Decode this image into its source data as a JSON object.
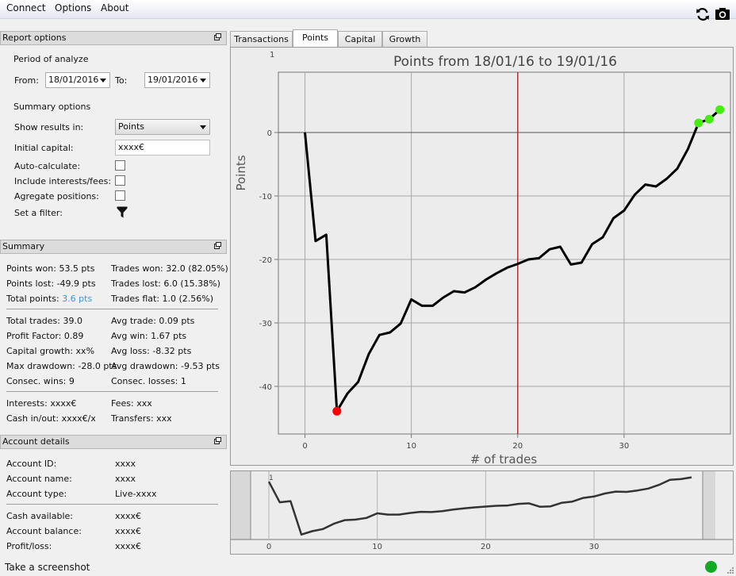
{
  "menu": {
    "connect": "Connect",
    "options": "Options",
    "about": "About"
  },
  "toolbar": {
    "refresh_icon": "refresh-icon",
    "camera_icon": "camera-icon"
  },
  "report_options": {
    "title": "Report options",
    "period_label": "Period of analyze",
    "from_label": "From:",
    "from_value": "18/01/2016",
    "to_label": "To:",
    "to_value": "19/01/2016",
    "summary_options_label": "Summary options",
    "show_results_label": "Show results in:",
    "show_results_value": "Points",
    "initial_capital_label": "Initial capital:",
    "initial_capital_value": "xxxx€",
    "auto_calc_label": "Auto-calculate:",
    "include_fees_label": "Include interests/fees:",
    "aggregate_label": "Agregate positions:",
    "filter_label": "Set a filter:"
  },
  "summary": {
    "title": "Summary",
    "points_won": "Points won: 53.5 pts",
    "trades_won": "Trades won: 32.0 (82.05%)",
    "points_lost": "Points lost: -49.9 pts",
    "trades_lost": "Trades lost: 6.0 (15.38%)",
    "total_points_label": "Total points:",
    "total_points_value": "3.6 pts",
    "trades_flat": "Trades flat: 1.0 (2.56%)",
    "total_trades": "Total trades: 39.0",
    "avg_trade": "Avg trade: 0.09 pts",
    "profit_factor": "Profit Factor: 0.89",
    "avg_win": "Avg win: 1.67 pts",
    "capital_growth": "Capital growth: xx%",
    "avg_loss": "Avg loss: -8.32 pts",
    "max_drawdown": "Max drawdown: -28.0 pts",
    "avg_drawdown": "Avg drawdown: -9.53 pts",
    "consec_wins": "Consec. wins: 9",
    "consec_losses": "Consec. losses: 1",
    "interests": "Interests: xxxx€",
    "fees": "Fees: xxx",
    "cash_inout": "Cash in/out: xxxx€/xxx",
    "transfers": "Transfers: xxxx"
  },
  "account": {
    "title": "Account details",
    "id_label": "Account ID:",
    "id_value": "xxxx",
    "name_label": "Account name:",
    "name_value": "xxxx",
    "type_label": "Account type:",
    "type_value": "Live-xxxx",
    "cash_label": "Cash available:",
    "cash_value": "xxxx€",
    "balance_label": "Account balance:",
    "balance_value": "xxxx€",
    "pl_label": "Profit/loss:",
    "pl_value": "xxxx€"
  },
  "tabs": [
    "Transactions",
    "Points",
    "Capital",
    "Growth"
  ],
  "active_tab": "Points",
  "status": {
    "text": "Take a screenshot",
    "indicator_color": "#11aa22"
  },
  "colors": {
    "line": "#000000",
    "min_marker": "#ff0000",
    "end_markers": "#44ee11",
    "vline": "#aa3333"
  },
  "chart_data": {
    "type": "line",
    "title": "Points from 18/01/16 to 19/01/16",
    "xlabel": "# of trades",
    "ylabel": "Points",
    "x_ticks": [
      0,
      10,
      20,
      30
    ],
    "y_ticks": [
      0,
      -10,
      -20,
      -30,
      -40
    ],
    "corner_label": "1",
    "xlim": [
      -2.5,
      40
    ],
    "ylim": [
      -47.5,
      9.5
    ],
    "grid": true,
    "vertical_marker_x": 20,
    "x": [
      0,
      1,
      2,
      3,
      4,
      5,
      6,
      7,
      8,
      9,
      10,
      11,
      12,
      13,
      14,
      15,
      16,
      17,
      18,
      19,
      20,
      21,
      22,
      23,
      24,
      25,
      26,
      27,
      28,
      29,
      30,
      31,
      32,
      33,
      34,
      35,
      36,
      37,
      38,
      39
    ],
    "values": [
      0,
      -17.1,
      -16.1,
      -43.9,
      -41.1,
      -39.3,
      -34.9,
      -31.9,
      -31.5,
      -30.1,
      -26.3,
      -27.3,
      -27.3,
      -26.0,
      -25.0,
      -25.2,
      -24.4,
      -23.2,
      -22.2,
      -21.3,
      -20.7,
      -20.0,
      -19.8,
      -18.4,
      -18.0,
      -20.8,
      -20.5,
      -17.6,
      -16.5,
      -13.5,
      -12.3,
      -9.8,
      -8.2,
      -8.5,
      -7.3,
      -5.7,
      -2.6,
      1.5,
      2.1,
      3.6
    ],
    "min_point_index": 3,
    "highlight_indices": [
      37,
      38,
      39
    ],
    "overview": {
      "x_ticks": [
        0,
        10,
        20,
        30
      ],
      "corner_label": "1"
    }
  }
}
